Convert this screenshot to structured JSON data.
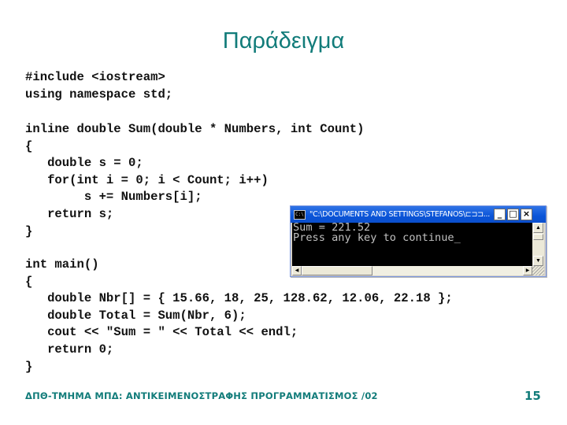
{
  "slide": {
    "title": "Παράδειγμα",
    "code_lines_header": [
      "#include <iostream>",
      "using namespace std;"
    ],
    "code_lines_function": [
      "inline double Sum(double * Numbers, int Count)",
      "{",
      "   double s = 0;",
      "   for(int i = 0; i < Count; i++)",
      "        s += Numbers[i];",
      "   return s;",
      "}"
    ],
    "code_lines_main": [
      "int main()",
      "{",
      "   double Nbr[] = { 15.66, 18, 25, 128.62, 12.06, 22.18 };",
      "   double Total = Sum(Nbr, 6);",
      "   cout << \"Sum = \" << Total << endl;",
      "   return 0;",
      "}"
    ],
    "footer": {
      "text": "ΔΠΘ-ΤΜΗΜΑ ΜΠΔ: ΑΝΤΙΚΕΙΜΕΝΟΣΤΡΑΦΗΣ ΠΡΟΓΡΑΜΜΑΤΙΣΜΟΣ /02",
      "page_number": "15"
    }
  },
  "console": {
    "title": "\"C:\\DOCUMENTS AND SETTINGS\\STEFANOS\\⊏⊐⊐...",
    "icon": "console-app-icon",
    "icon_glyph": "C:\\",
    "buttons": {
      "minimize": "_",
      "maximize": "□",
      "close": "×"
    },
    "output_lines": [
      "Sum = 221.52",
      "Press any key to continue_"
    ],
    "scroll_up": "▲",
    "scroll_down": "▼",
    "scroll_left": "◀",
    "scroll_right": "▶"
  }
}
